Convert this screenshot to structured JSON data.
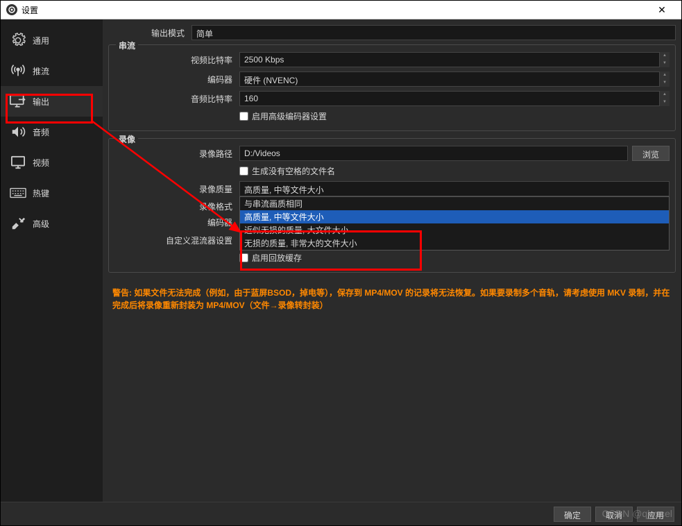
{
  "titlebar": {
    "title": "设置",
    "close": "✕"
  },
  "sidebar": {
    "items": [
      {
        "label": "通用",
        "icon": "gear"
      },
      {
        "label": "推流",
        "icon": "antenna"
      },
      {
        "label": "输出",
        "icon": "monitor-arrow"
      },
      {
        "label": "音频",
        "icon": "speaker"
      },
      {
        "label": "视频",
        "icon": "monitor"
      },
      {
        "label": "热键",
        "icon": "keyboard"
      },
      {
        "label": "高级",
        "icon": "tools"
      }
    ]
  },
  "output_mode": {
    "label": "输出模式",
    "value": "简单"
  },
  "streaming": {
    "title": "串流",
    "video_bitrate_label": "视频比特率",
    "video_bitrate_value": "2500 Kbps",
    "encoder_label": "编码器",
    "encoder_value": "硬件 (NVENC)",
    "audio_bitrate_label": "音频比特率",
    "audio_bitrate_value": "160",
    "advanced_encoder_label": "启用高级编码器设置"
  },
  "recording": {
    "title": "录像",
    "path_label": "录像路径",
    "path_value": "D:/Videos",
    "browse": "浏览",
    "no_space_label": "生成没有空格的文件名",
    "quality_label": "录像质量",
    "quality_value": "高质量, 中等文件大小",
    "quality_options": [
      "与串流画质相同",
      "高质量, 中等文件大小",
      "近似无损的质量, 大文件大小",
      "无损的质量, 非常大的文件大小"
    ],
    "format_label": "录像格式",
    "encoder_label": "编码器",
    "muxer_label": "自定义混流器设置",
    "replay_buffer_label": "启用回放缓存"
  },
  "warning_text": "警告: 如果文件无法完成（例如，由于蓝屏BSOD，掉电等），保存到 MP4/MOV 的记录将无法恢复。如果要录制多个音轨，请考虑使用 MKV 录制，并在完成后将录像重新封装为 MP4/MOV（文件→录像转封装）",
  "footer": {
    "ok": "确定",
    "cancel": "取消",
    "apply": "应用"
  },
  "watermark": "CSDN @qlexcel"
}
